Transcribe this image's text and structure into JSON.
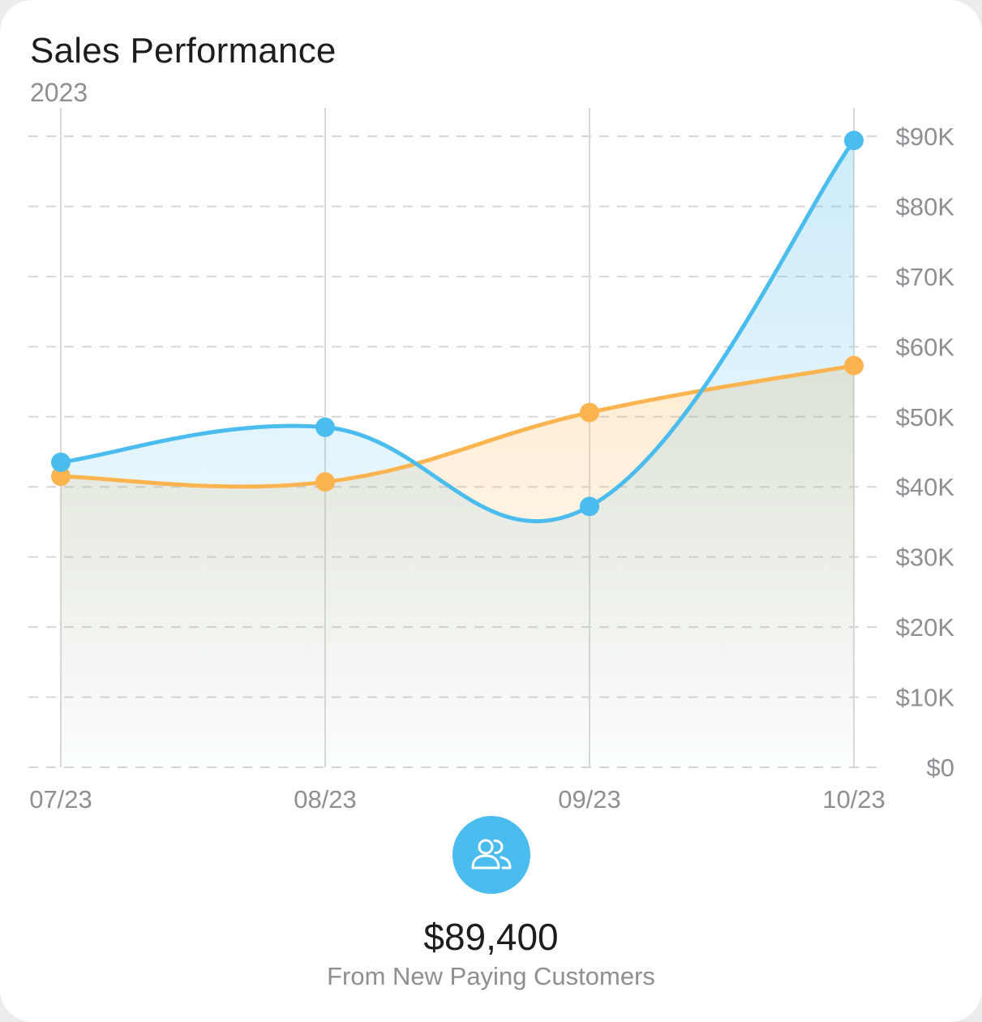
{
  "card": {
    "title": "Sales Performance",
    "subtitle": "2023"
  },
  "chart_data": {
    "type": "area",
    "x": [
      "07/23",
      "08/23",
      "09/23",
      "10/23"
    ],
    "series": [
      {
        "color": "#4bbcee",
        "values": [
          43500,
          48500,
          37200,
          89400
        ]
      },
      {
        "color": "#fbb450",
        "values": [
          41500,
          40700,
          50600,
          57300
        ]
      }
    ],
    "ylim": [
      0,
      90000
    ],
    "y_ticks": [
      "$90K",
      "$80K",
      "$70K",
      "$60K",
      "$50K",
      "$40K",
      "$30K",
      "$20K",
      "$10K",
      "$0"
    ],
    "y_tick_values": [
      90000,
      80000,
      70000,
      60000,
      50000,
      40000,
      30000,
      20000,
      10000,
      0
    ],
    "y_axis_position": "right",
    "grid": true
  },
  "summary": {
    "icon": "users-icon",
    "icon_bg": "#4bbcee",
    "value": "$89,400",
    "label": "From New Paying Customers"
  }
}
